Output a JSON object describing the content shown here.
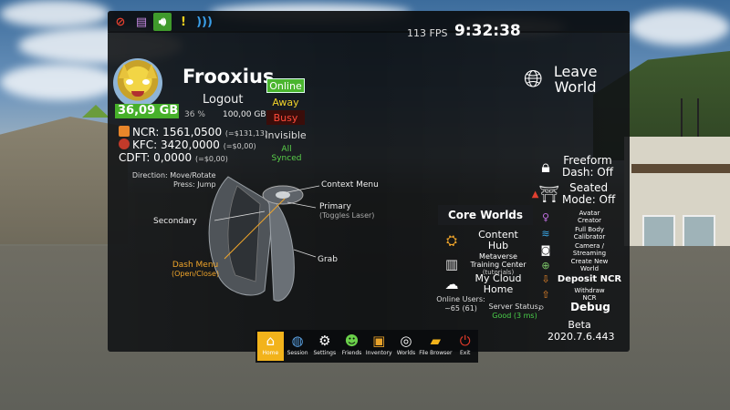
{
  "top_bar": {
    "icons": [
      "no-entry-icon",
      "book-icon",
      "volume-icon",
      "warning-icon",
      "wifi-icon"
    ],
    "fps": "113 FPS",
    "time": "9:32:38"
  },
  "profile": {
    "username": "Frooxius",
    "logout_label": "Logout",
    "storage_used": "36,09 GB",
    "storage_percent": "36 %",
    "storage_total": "100,00 GB",
    "storage_fraction": 0.36
  },
  "status_options": {
    "online": "Online",
    "away": "Away",
    "busy": "Busy",
    "invisible": "Invisible",
    "sync_line1": "All",
    "sync_line2": "Synced"
  },
  "currencies": [
    {
      "label": "NCR: 1561,0500",
      "value": "(=$131,13)",
      "color": "#e8862a"
    },
    {
      "label": "KFC: 3420,0000",
      "value": "(=$0,00)",
      "color": "#c23a2a"
    },
    {
      "label": "CDFT: 0,0000",
      "value": "(=$0,00)",
      "color": ""
    }
  ],
  "controller": {
    "direction_line1": "Direction: Move/Rotate",
    "direction_line2": "Press: Jump",
    "context_menu": "Context Menu",
    "primary": "Primary",
    "primary_sub": "(Toggles Laser)",
    "secondary": "Secondary",
    "grab": "Grab",
    "dash_menu": "Dash Menu",
    "dash_menu_sub": "(Open/Close)"
  },
  "core_worlds": {
    "title": "Core Worlds",
    "items": [
      {
        "label": "Content",
        "label2": "Hub",
        "sub": "",
        "icon": "hub-icon"
      },
      {
        "label": "Metaverse",
        "label2": "Training Center",
        "sub": "(tutorials)",
        "icon": "training-icon"
      },
      {
        "label": "My Cloud",
        "label2": "Home",
        "sub": "",
        "icon": "cloud-home-icon"
      }
    ],
    "online_users_label": "Online Users:",
    "online_users_value": "~65 (61)",
    "server_status_label": "Server Status:",
    "server_status_value": "Good (3 ms)"
  },
  "right_panel": {
    "leave_line1": "Leave",
    "leave_line2": "World",
    "freeform_line1": "Freeform",
    "freeform_line2": "Dash: Off",
    "seated_line1": "Seated",
    "seated_line2": "Mode: Off",
    "avatar_creator_1": "Avatar",
    "avatar_creator_2": "Creator",
    "fbc_1": "Full Body",
    "fbc_2": "Calibrator",
    "camera_1": "Camera /",
    "camera_2": "Streaming",
    "create_world_1": "Create New",
    "create_world_2": "World",
    "deposit": "Deposit NCR",
    "withdraw_1": "Withdraw",
    "withdraw_2": "NCR",
    "debug": "Debug",
    "version_line1": "Beta",
    "version_line2": "2020.7.6.443"
  },
  "dash": {
    "buttons": [
      {
        "label": "Home",
        "icon": "home-icon",
        "active": true
      },
      {
        "label": "Session",
        "icon": "globe-icon",
        "active": false
      },
      {
        "label": "Settings",
        "icon": "gear-icon",
        "active": false
      },
      {
        "label": "Friends",
        "icon": "friends-icon",
        "active": false
      },
      {
        "label": "Inventory",
        "icon": "inventory-icon",
        "active": false
      },
      {
        "label": "Worlds",
        "icon": "worlds-icon",
        "active": false
      },
      {
        "label": "File Browser",
        "icon": "folder-icon",
        "active": false
      },
      {
        "label": "Exit",
        "icon": "power-icon",
        "active": false
      }
    ]
  },
  "colors": {
    "accent_green": "#46b02a",
    "home_active": "#f2b31b",
    "busy_red": "#ff4a3a",
    "away_yellow": "#f0d22a",
    "dash_menu_orange": "#f0a52a"
  }
}
